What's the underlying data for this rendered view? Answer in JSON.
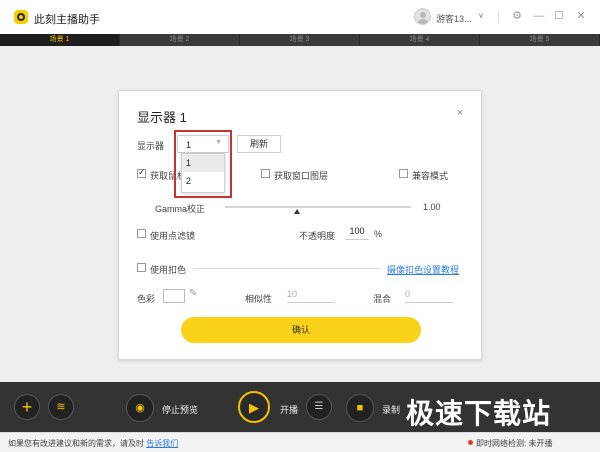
{
  "app": {
    "title": "此刻主播助手",
    "username": "游客13...",
    "user_caret": "∨"
  },
  "window_controls": {
    "settings": "⚙",
    "minimize": "—",
    "maximize": "☐",
    "close": "✕"
  },
  "scene_tabs": [
    {
      "label": "场景 1",
      "active": true
    },
    {
      "label": "场景 2",
      "active": false
    },
    {
      "label": "场景 3",
      "active": false
    },
    {
      "label": "场景 4",
      "active": false
    },
    {
      "label": "场景 5",
      "active": false
    }
  ],
  "dialog": {
    "title": "显示器 1",
    "close": "×",
    "monitor_label": "显示器",
    "monitor_value": "1",
    "monitor_options": [
      "1",
      "2"
    ],
    "refresh": "刷新",
    "capture_mouse": "获取鼠标",
    "capture_layered": "获取窗口图层",
    "compat_mode": "兼容模式",
    "gamma_label": "Gamma校正",
    "gamma_value": "1.00",
    "gamma_level": 0.4,
    "use_filter": "使用点滤镜",
    "opacity_label": "不透明度",
    "opacity_value": "100",
    "opacity_unit": "%",
    "use_chroma": "使用扣色",
    "chroma_link": "摄像扣色设置教程",
    "color_label": "色彩",
    "similarity_label": "相似性",
    "similarity_value": "10",
    "blend_label": "混合",
    "blend_value": "0",
    "confirm": "确认"
  },
  "bottombar": {
    "stop_preview": "停止预览",
    "start_live": "开播",
    "record": "录制",
    "watermark": "极速下载站"
  },
  "statusbar": {
    "feedback": "如果您有改进建议和新的需求，请及时",
    "feedback_link": "告诉我们",
    "net_label": "即时网络检测:",
    "net_status": "未开播"
  },
  "colors": {
    "accent": "#fbd21a",
    "highlight_box": "#c8312e",
    "link": "#2f7fd6"
  }
}
